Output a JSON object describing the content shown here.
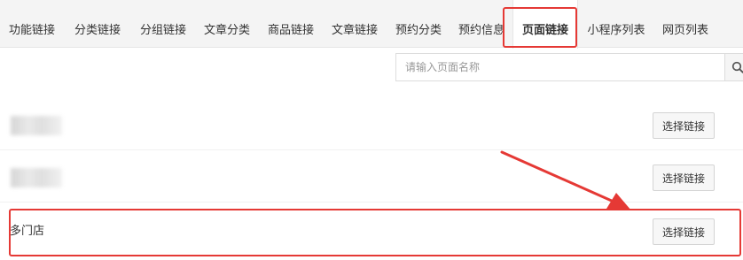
{
  "tabs": [
    {
      "label": "功能链接"
    },
    {
      "label": "分类链接"
    },
    {
      "label": "分组链接"
    },
    {
      "label": "文章分类"
    },
    {
      "label": "商品链接"
    },
    {
      "label": "文章链接"
    },
    {
      "label": "预约分类"
    },
    {
      "label": "预约信息"
    },
    {
      "label": "页面链接",
      "active": true
    },
    {
      "label": "小程序列表"
    },
    {
      "label": "网页列表"
    }
  ],
  "search": {
    "placeholder": "请输入页面名称",
    "value": "",
    "icon": "search-icon"
  },
  "rows": [
    {
      "name": "",
      "redacted": true,
      "button": "选择链接"
    },
    {
      "name": "",
      "redacted": true,
      "button": "选择链接"
    },
    {
      "name": "多门店",
      "redacted": false,
      "button": "选择链接"
    }
  ],
  "colors": {
    "highlight": "#e53935",
    "tabbar": "#f4f4f4",
    "border": "#dddddd"
  }
}
